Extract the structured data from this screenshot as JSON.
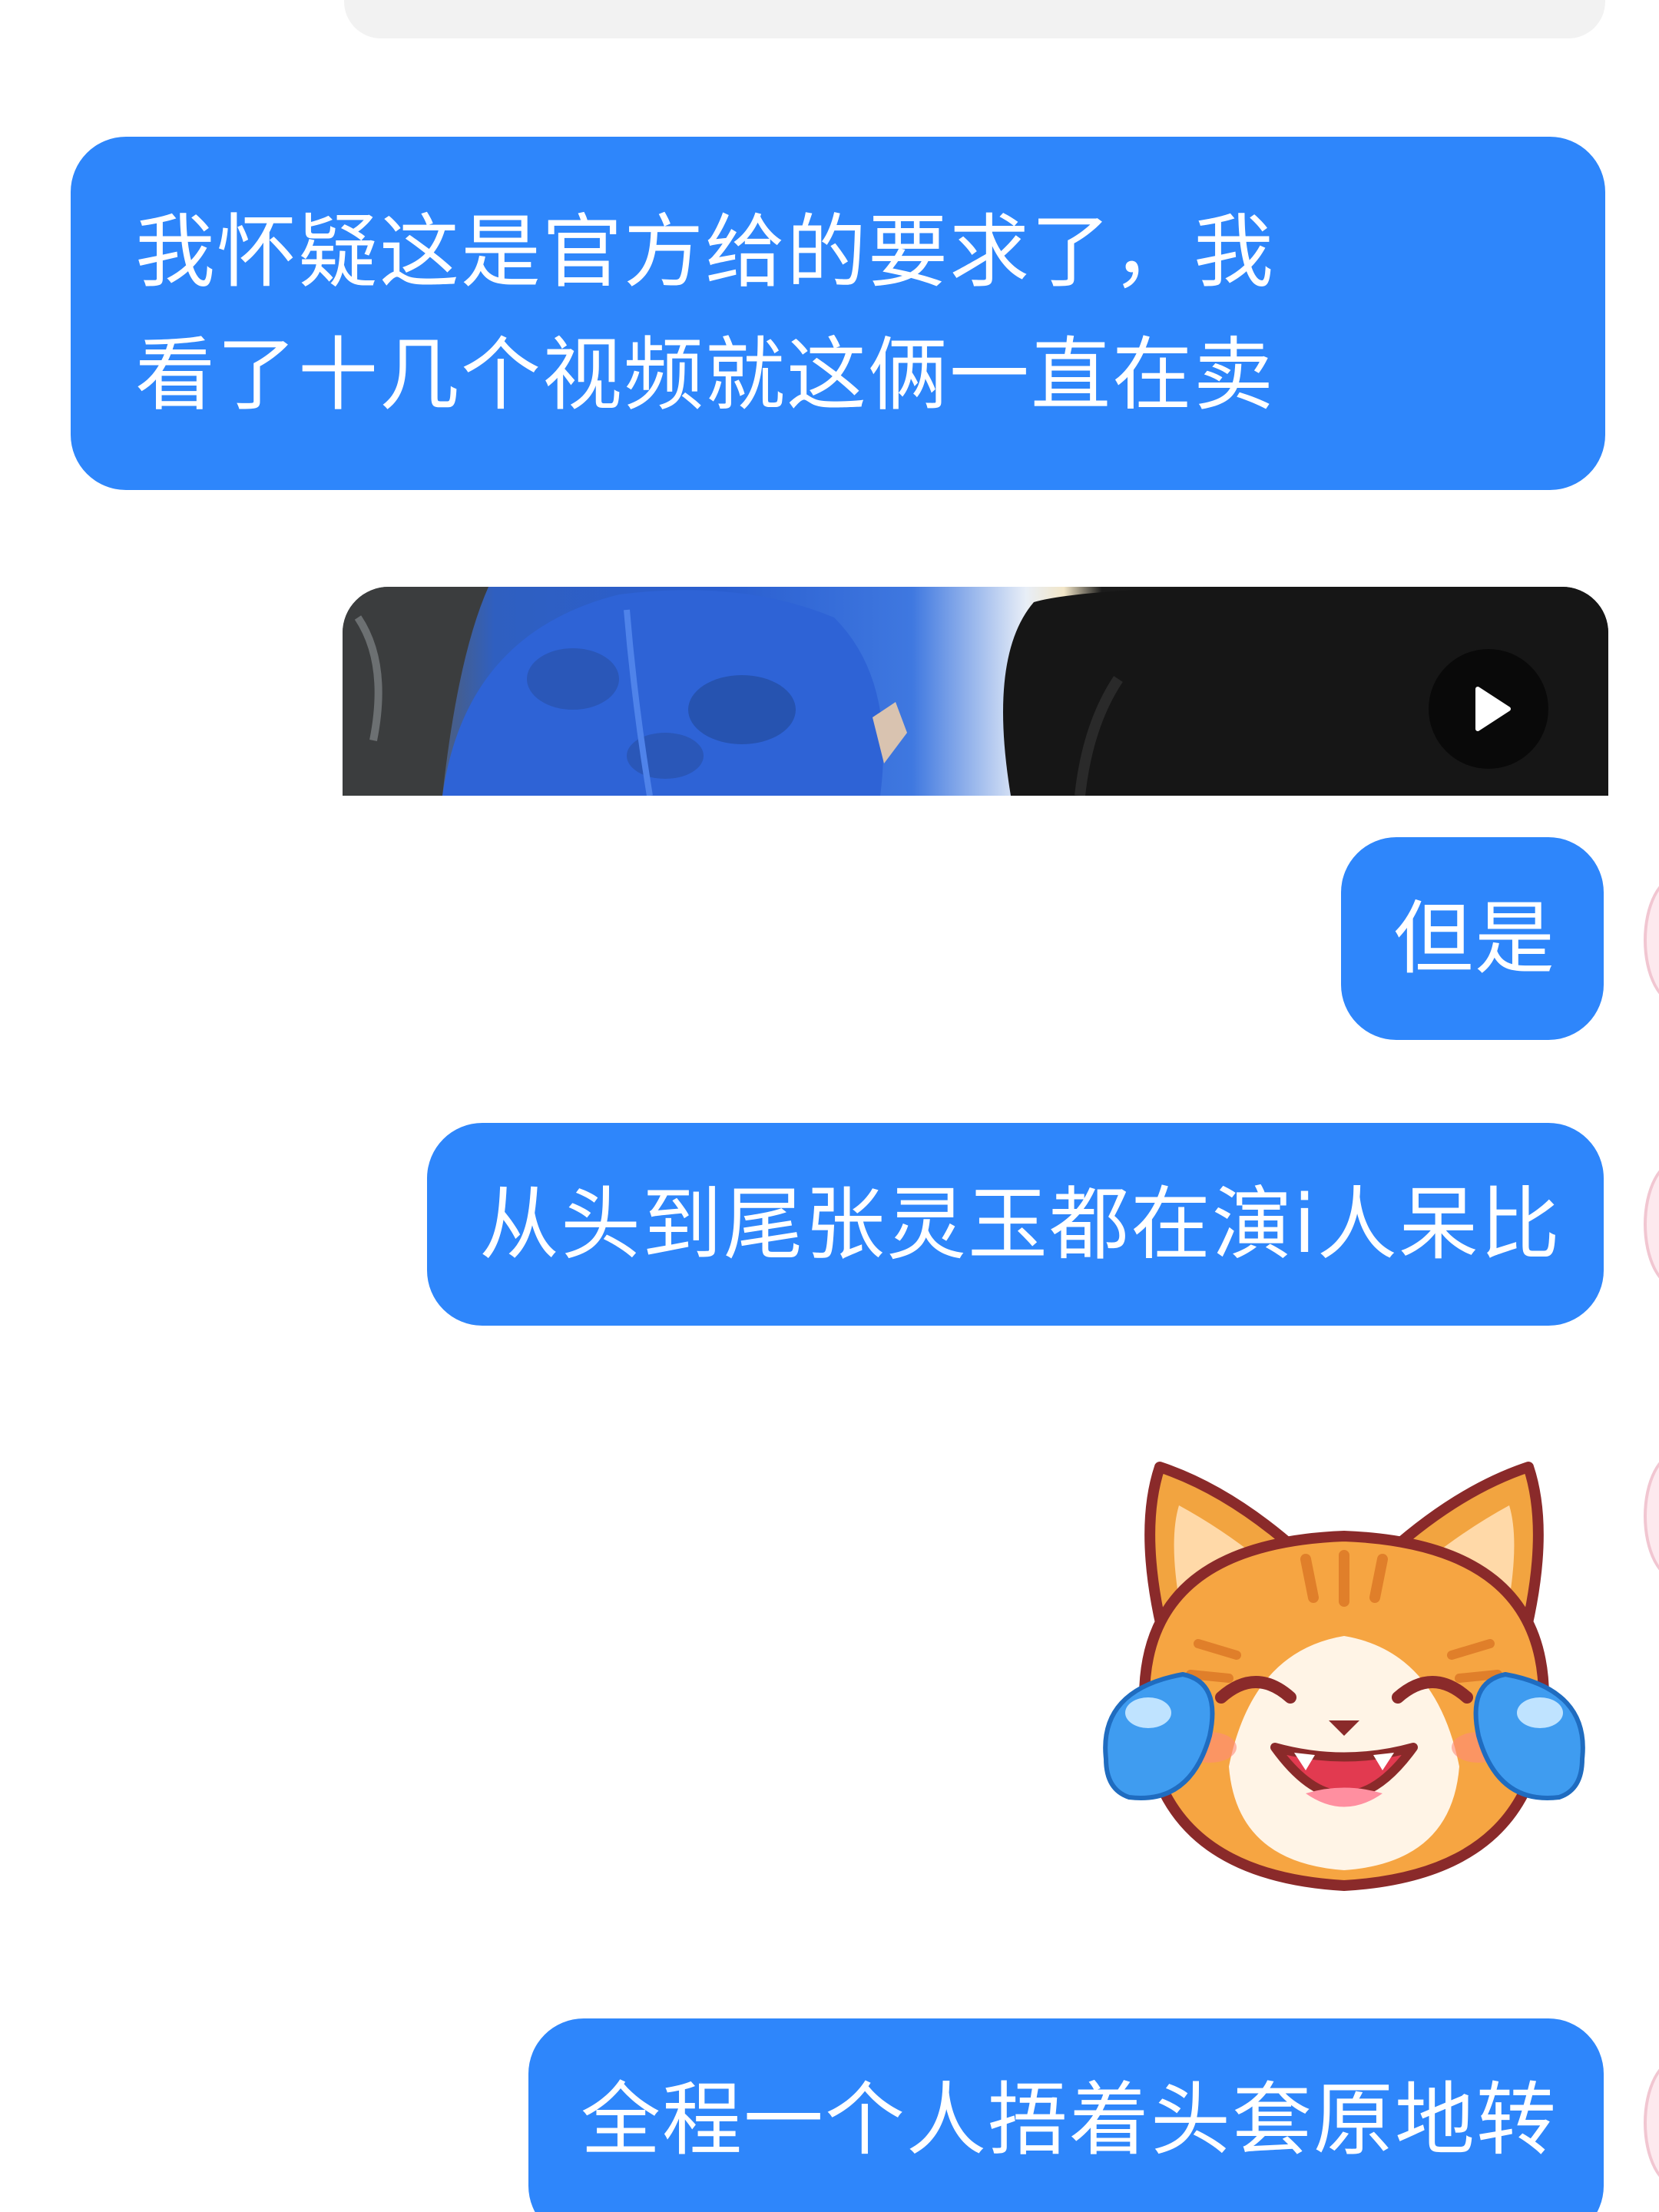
{
  "messages": [
    {
      "type": "text",
      "lines": [
        "我怀疑这是官方给的要求了，我",
        "看了十几个视频就这俩一直在卖"
      ]
    },
    {
      "type": "video",
      "icon": "play-icon"
    },
    {
      "type": "text",
      "text": "但是"
    },
    {
      "type": "text",
      "text": "从头到尾张灵玉都在演i人呆比"
    },
    {
      "type": "sticker",
      "icon": "laughing-crying-cat-sticker"
    },
    {
      "type": "text",
      "text": "全程一个人捂着头套原地转"
    }
  ],
  "colors": {
    "bubble": "#2e86fb",
    "bubble_text": "#ffffff",
    "background": "#ffffff"
  }
}
